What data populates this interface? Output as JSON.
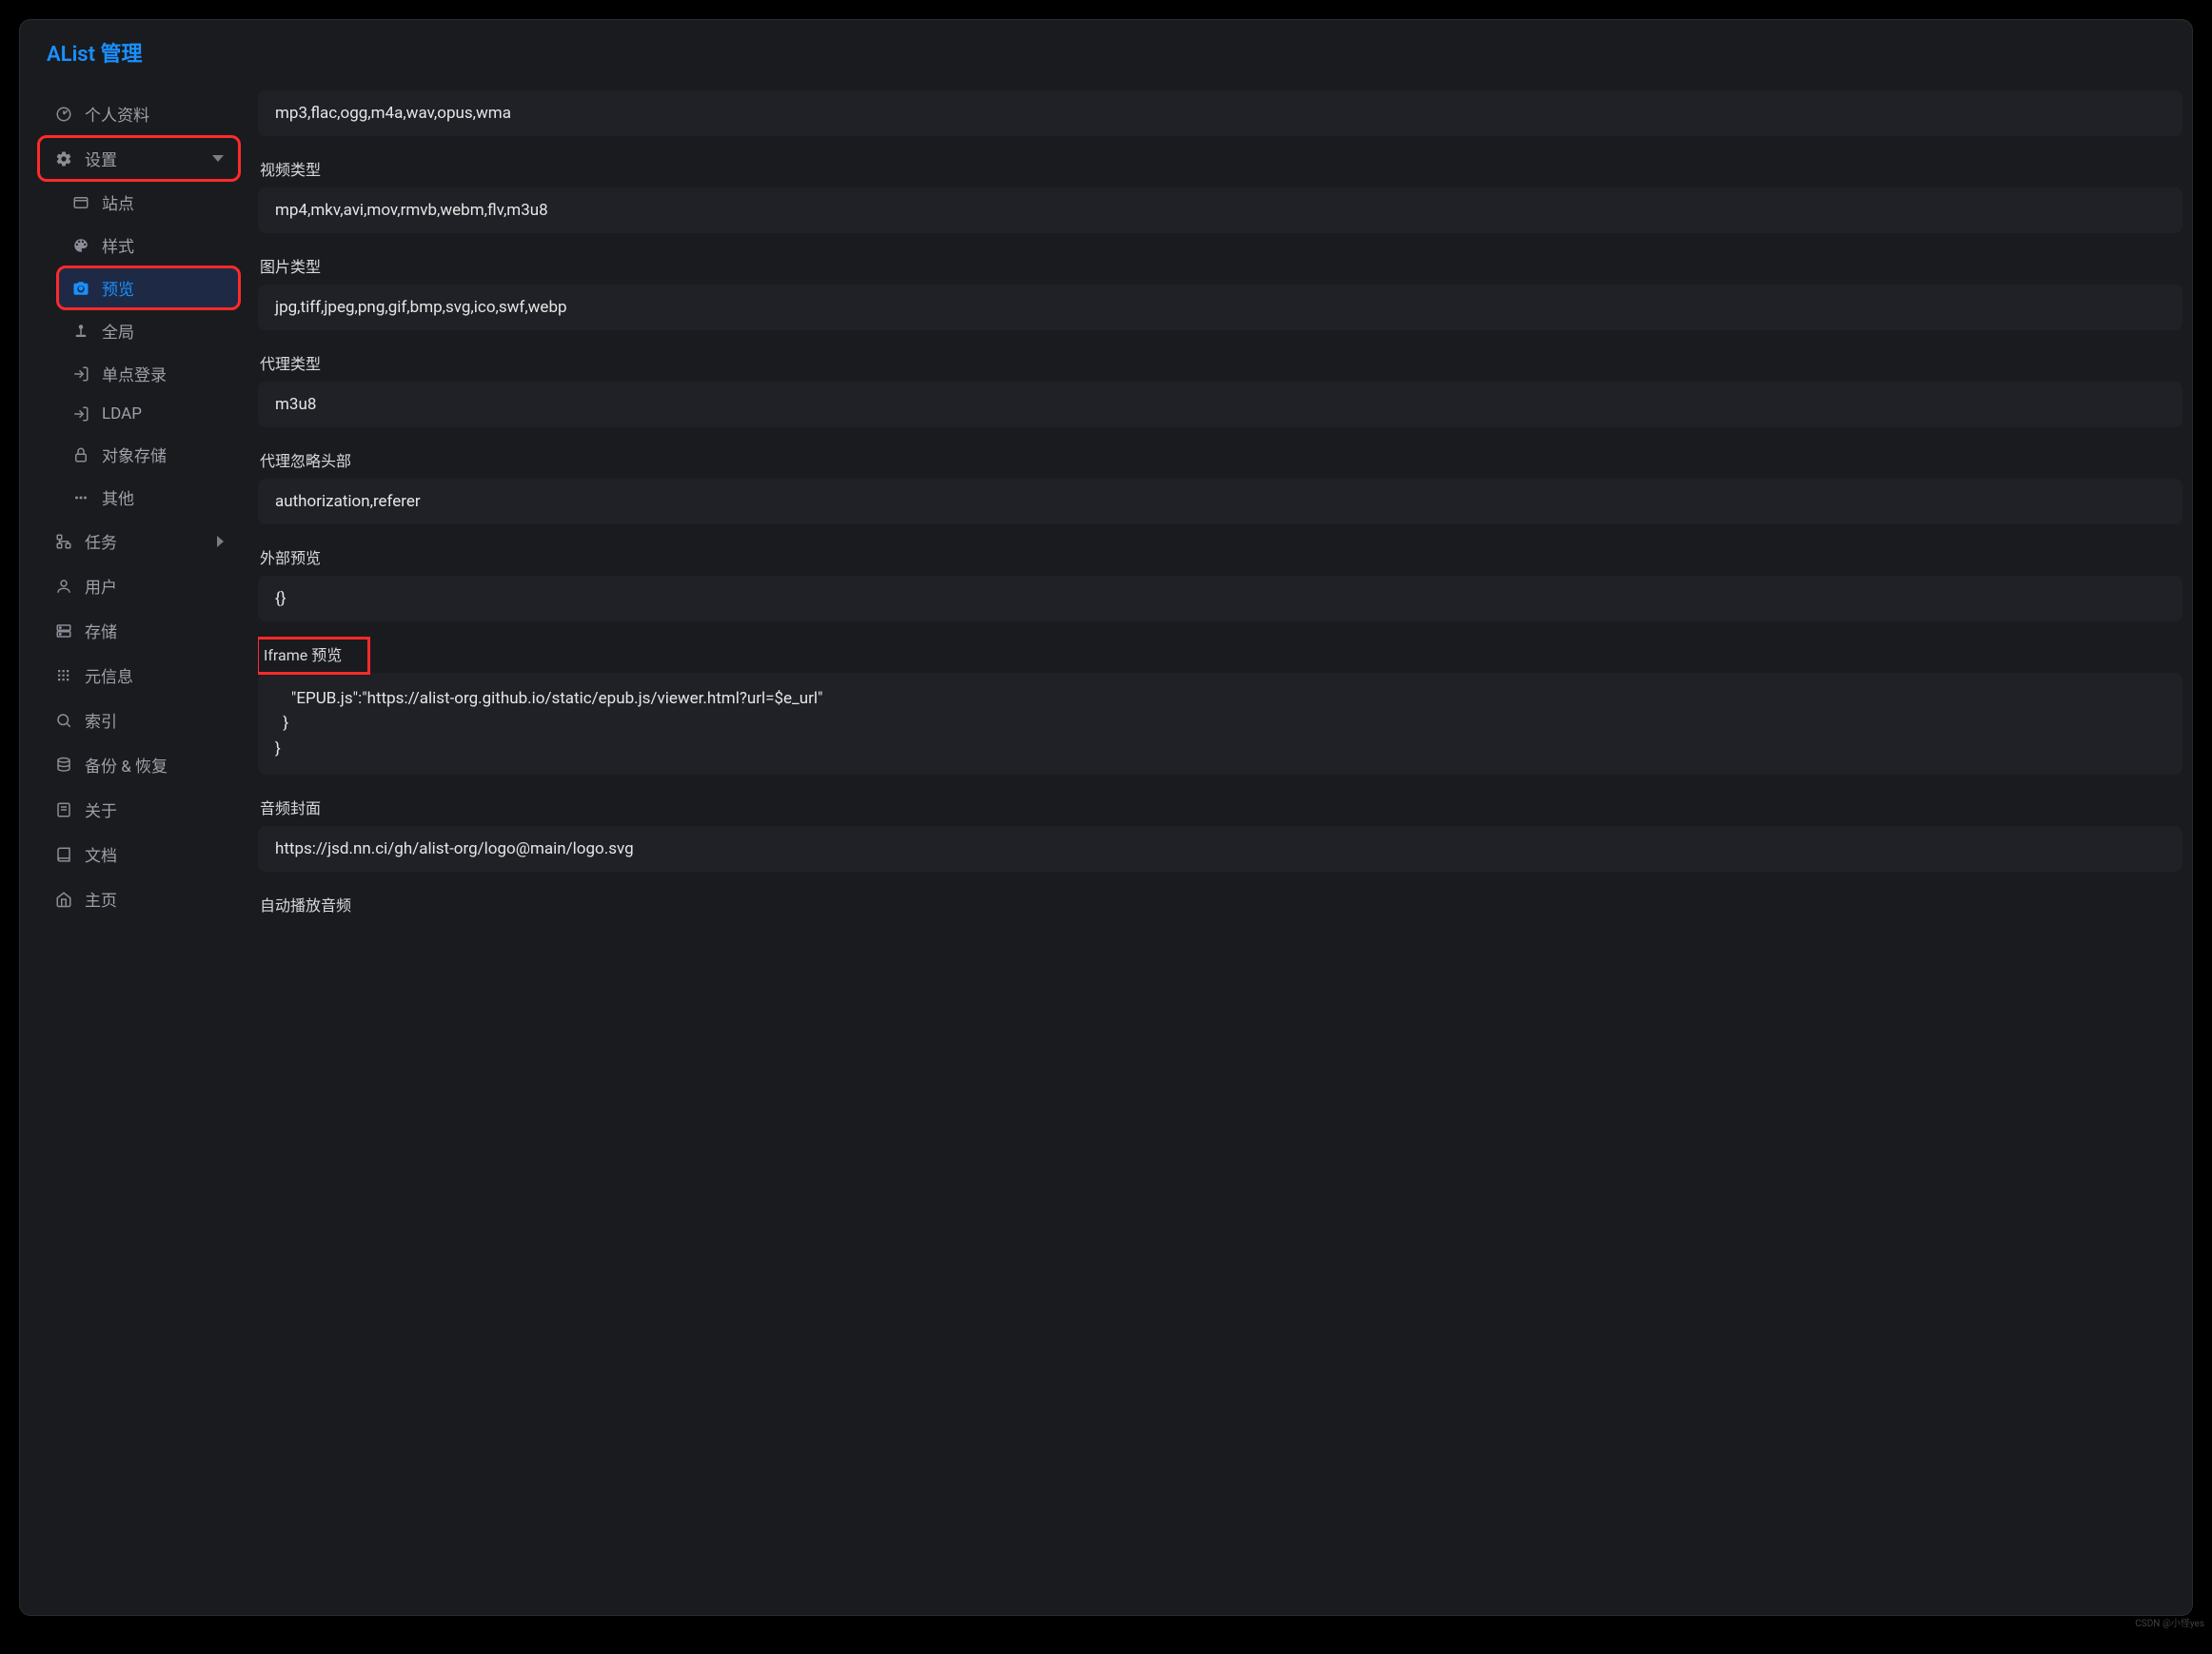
{
  "brand": "AList 管理",
  "sidebar": {
    "profile": {
      "label": "个人资料"
    },
    "settings": {
      "label": "设置",
      "items": {
        "site": "站点",
        "style": "样式",
        "preview": "预览",
        "global": "全局",
        "sso": "单点登录",
        "ldap": "LDAP",
        "storage_obj": "对象存储",
        "other": "其他"
      }
    },
    "tasks": {
      "label": "任务"
    },
    "users": {
      "label": "用户"
    },
    "storage": {
      "label": "存储"
    },
    "metas": {
      "label": "元信息"
    },
    "indexes": {
      "label": "索引"
    },
    "backup": {
      "label": "备份 & 恢复"
    },
    "about": {
      "label": "关于"
    },
    "docs": {
      "label": "文档"
    },
    "home": {
      "label": "主页"
    }
  },
  "fields": {
    "audio_types": {
      "value": "mp3,flac,ogg,m4a,wav,opus,wma"
    },
    "video_types": {
      "label": "视频类型",
      "value": "mp4,mkv,avi,mov,rmvb,webm,flv,m3u8"
    },
    "image_types": {
      "label": "图片类型",
      "value": "jpg,tiff,jpeg,png,gif,bmp,svg,ico,swf,webp"
    },
    "proxy_types": {
      "label": "代理类型",
      "value": "m3u8"
    },
    "proxy_ignore_headers": {
      "label": "代理忽略头部",
      "value": "authorization,referer"
    },
    "external_preview": {
      "label": "外部预览",
      "value": "{}"
    },
    "iframe_preview": {
      "label": "Iframe 预览",
      "value": "    \"EPUB.js\":\"https://alist-org.github.io/static/epub.js/viewer.html?url=$e_url\"\n  }\n}"
    },
    "audio_cover": {
      "label": "音频封面",
      "value": "https://jsd.nn.ci/gh/alist-org/logo@main/logo.svg"
    },
    "autoplay_audio": {
      "label": "自动播放音频"
    }
  },
  "watermark": "CSDN @小怪yes"
}
